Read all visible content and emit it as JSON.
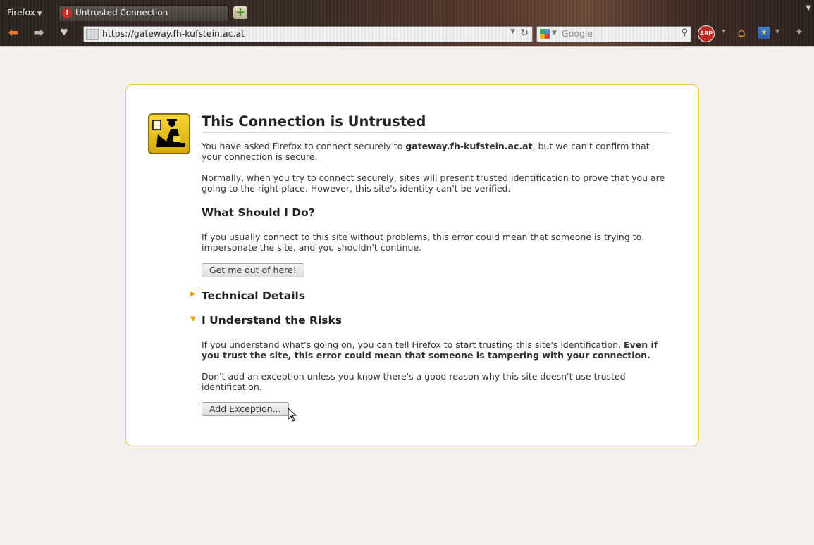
{
  "browser": {
    "app_menu": "Firefox",
    "tab_title": "Untrusted Connection",
    "url": "https://gateway.fh-kufstein.ac.at",
    "search_placeholder": "Google",
    "abp_label": "ABP"
  },
  "icons": {
    "app_menu_caret": "chevron-down-icon",
    "tab_warning": "warning-icon",
    "new_tab": "plus-icon",
    "back": "back-arrow-icon",
    "forward": "forward-arrow-icon",
    "bookmark": "star-icon",
    "site_identity": "page-icon",
    "url_dropdown": "chevron-down-icon",
    "reload": "reload-icon",
    "search_engine": "google-icon",
    "search_go": "magnifier-icon",
    "adblock": "adblock-plus-icon",
    "home": "home-icon",
    "bookmarks_menu": "bookmarks-icon",
    "extension": "puzzle-icon",
    "error_shield": "security-officer-icon",
    "expander_closed": "triangle-right-icon",
    "expander_open": "triangle-down-icon",
    "cursor": "mouse-cursor-icon"
  },
  "error": {
    "title": "This Connection is Untrusted",
    "p1_a": "You have asked Firefox to connect securely to ",
    "p1_host": "gateway.fh-kufstein.ac.at",
    "p1_b": ", but we can't confirm that your connection is secure.",
    "p2": "Normally, when you try to connect securely, sites will present trusted identification to prove that you are going to the right place. However, this site's identity can't be verified.",
    "what_heading": "What Should I Do?",
    "p3": "If you usually connect to this site without problems, this error could mean that someone is trying to impersonate the site, and you shouldn't continue.",
    "get_out_button": "Get me out of here!",
    "technical_heading": "Technical Details",
    "risks_heading": "I Understand the Risks",
    "p4_a": "If you understand what's going on, you can tell Firefox to start trusting this site's identification. ",
    "p4_bold": "Even if you trust the site, this error could mean that someone is tampering with your connection.",
    "p5": "Don't add an exception unless you know there's a good reason why this site doesn't use trusted identification.",
    "add_exception_button": "Add Exception..."
  },
  "colors": {
    "chrome_bg": "#3a2c26",
    "page_bg": "#f2f1ef",
    "box_border": "#f0c645",
    "expander": "#f0a30a",
    "back_arrow": "#f07a2a"
  }
}
